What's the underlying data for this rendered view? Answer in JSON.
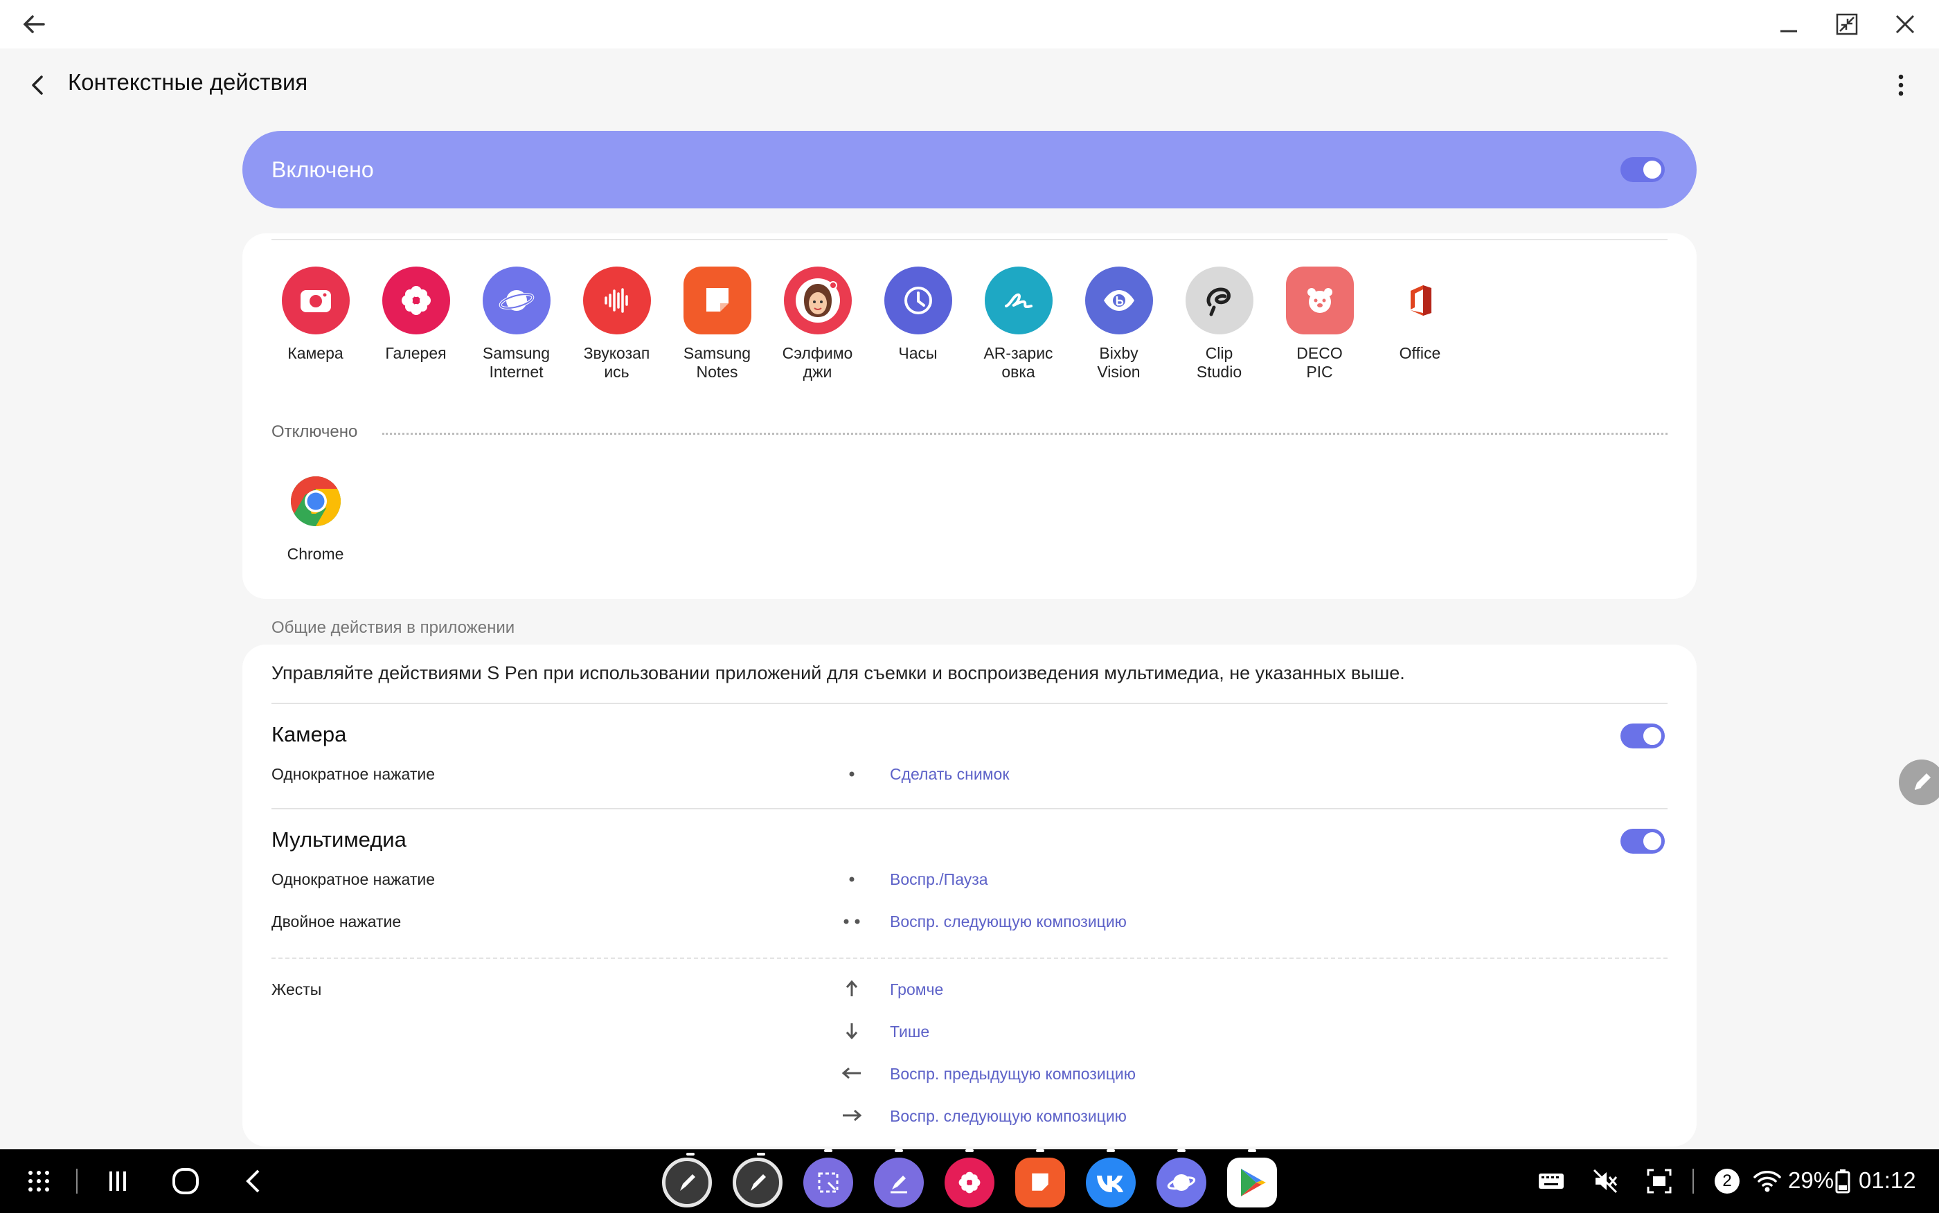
{
  "header": {
    "title": "Контекстные действия"
  },
  "master": {
    "label": "Включено",
    "on": true
  },
  "enabled_apps": [
    {
      "name": "Камера",
      "icon": "camera-icon",
      "color": "#e8334e"
    },
    {
      "name": "Галерея",
      "icon": "gallery-icon",
      "color": "#e51d57"
    },
    {
      "name": "Samsung Internet",
      "icon": "samsung-internet-icon",
      "color": "#6f74ea"
    },
    {
      "name": "Звукозап ись",
      "icon": "voice-recorder-icon",
      "color": "#ec3a3a"
    },
    {
      "name": "Samsung Notes",
      "icon": "samsung-notes-icon",
      "color": "#f25b29"
    },
    {
      "name": "Сэлфимо джи",
      "icon": "selfie-emoji-icon",
      "color": "#ea3b4f"
    },
    {
      "name": "Часы",
      "icon": "clock-icon",
      "color": "#5a62d9"
    },
    {
      "name": "AR-зарис овка",
      "icon": "ar-doodle-icon",
      "color": "#1ea8c4"
    },
    {
      "name": "Bixby Vision",
      "icon": "bixby-vision-icon",
      "color": "#5b6ad8"
    },
    {
      "name": "Clip Studio",
      "icon": "clip-studio-icon",
      "color": "#d9d9d9"
    },
    {
      "name": "DECO PIC",
      "icon": "deco-pic-icon",
      "color": "#ee6e6e"
    },
    {
      "name": "Office",
      "icon": "office-icon",
      "color": "#ffffff"
    }
  ],
  "disabled": {
    "label": "Отключено",
    "apps": [
      {
        "name": "Chrome",
        "icon": "chrome-icon"
      }
    ]
  },
  "general": {
    "section_label": "Общие действия в приложении",
    "description": "Управляйте действиями S Pen при использовании приложений для съемки и воспроизведения мультимедиа, не указанных выше.",
    "camera": {
      "title": "Камера",
      "rows": [
        {
          "label": "Однократное нажатие",
          "value": "Сделать снимок"
        }
      ]
    },
    "media": {
      "title": "Мультимедиа",
      "rows": [
        {
          "label": "Однократное нажатие",
          "value": "Воспр./Пауза"
        },
        {
          "label": "Двойное нажатие",
          "value": "Воспр. следующую композицию"
        }
      ],
      "gestures_label": "Жесты",
      "gestures": [
        {
          "dir": "up",
          "value": "Громче"
        },
        {
          "dir": "down",
          "value": "Тише"
        },
        {
          "dir": "left",
          "value": "Воспр. предыдущую композицию"
        },
        {
          "dir": "right",
          "value": "Воспр. следующую композицию"
        }
      ]
    }
  },
  "status": {
    "notifications": "2",
    "battery": "29%",
    "time": "01:12"
  },
  "colors": {
    "accent": "#6a72e8",
    "master_bg": "#9098f4",
    "link": "#5d62c8"
  }
}
